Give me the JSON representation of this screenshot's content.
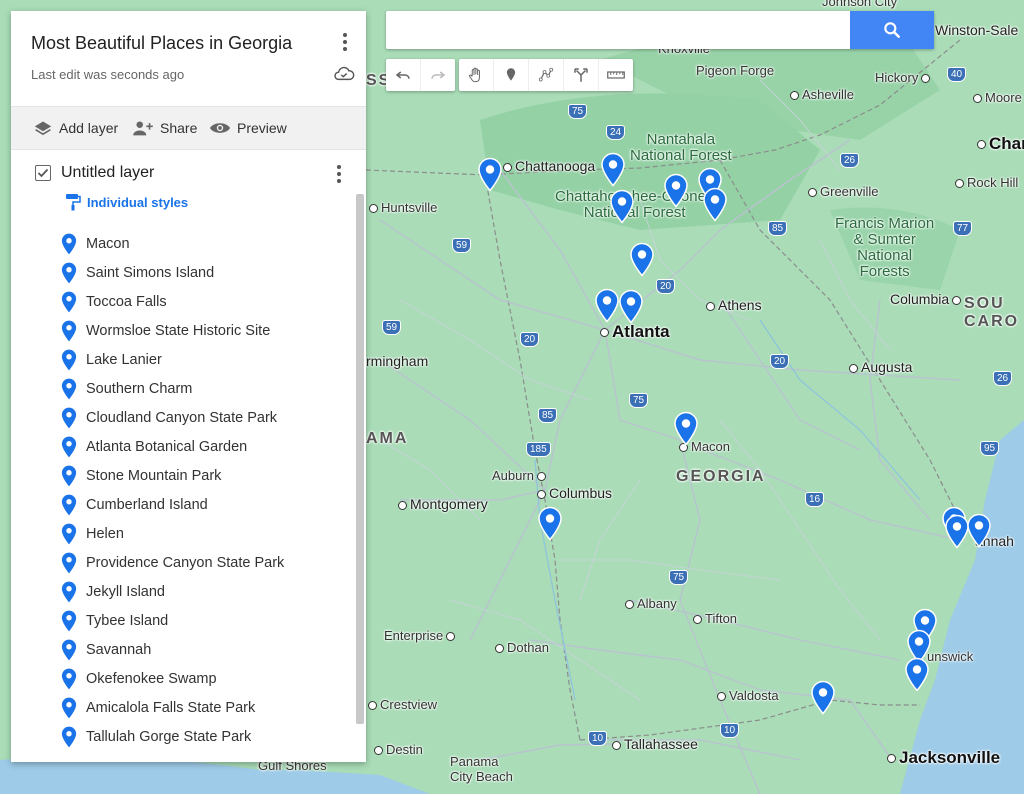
{
  "panel": {
    "title": "Most Beautiful Places in Georgia",
    "last_edit": "Last edit was seconds ago",
    "actions": {
      "add_layer": "Add layer",
      "share": "Share",
      "preview": "Preview"
    },
    "layer": {
      "name": "Untitled layer",
      "styles_label": "Individual styles",
      "places": [
        "Macon",
        "Saint Simons Island",
        "Toccoa Falls",
        "Wormsloe State Historic Site",
        "Lake Lanier",
        "Southern Charm",
        "Cloudland Canyon State Park",
        "Atlanta Botanical Garden",
        "Stone Mountain Park",
        "Cumberland Island",
        "Helen",
        "Providence Canyon State Park",
        "Jekyll Island",
        "Tybee Island",
        "Savannah",
        "Okefenokee Swamp",
        "Amicalola Falls State Park",
        "Tallulah Gorge State Park"
      ]
    }
  },
  "search": {
    "value": "",
    "placeholder": ""
  },
  "colors": {
    "accent": "#4285f4",
    "pin": "#1a73e8",
    "link": "#1a73e8"
  },
  "map_labels": {
    "chattanooga": "Chattanooga",
    "knoxville": "Knoxville",
    "pigeon_forge": "Pigeon Forge",
    "johnson_city": "Johnson City",
    "asheville": "Asheville",
    "hickory": "Hickory",
    "winston_salem": "Winston-Sale",
    "char": "Char",
    "moore": "Moore",
    "rock_hill": "Rock Hill",
    "greenville": "Greenville",
    "huntsville": "Huntsville",
    "nantahala": "Nantahala\nNational Forest",
    "chattahoochee": "Chattahoochee-Oconee\nNational Forest",
    "francis_marion": "Francis Marion\n& Sumter\nNational\nForests",
    "columbia": "Columbia",
    "south_carolina": "SOU\nCARO",
    "athens": "Athens",
    "atlanta": "Atlanta",
    "birmingham": "rmingham",
    "augusta": "Augusta",
    "alabama": "AMA",
    "macon": "Macon",
    "georgia": "GEORGIA",
    "auburn": "Auburn",
    "columbus": "Columbus",
    "montgomery": "Montgomery",
    "savannah": "annah",
    "albany": "Albany",
    "tifton": "Tifton",
    "enterprise": "Enterprise",
    "dothan": "Dothan",
    "brunswick": "unswick",
    "valdosta": "Valdosta",
    "crestview": "Crestview",
    "destin": "Destin",
    "tallahassee": "Tallahassee",
    "panama_city": "Panama\nCity Beach",
    "gulf_shores": "Gulf Shores",
    "jacksonville": "Jacksonville",
    "ss": "SS"
  },
  "highways": [
    "75",
    "26",
    "40",
    "24",
    "59",
    "85",
    "77",
    "20",
    "20",
    "59",
    "85",
    "185",
    "75",
    "16",
    "20",
    "26",
    "95",
    "75",
    "10",
    "10"
  ]
}
